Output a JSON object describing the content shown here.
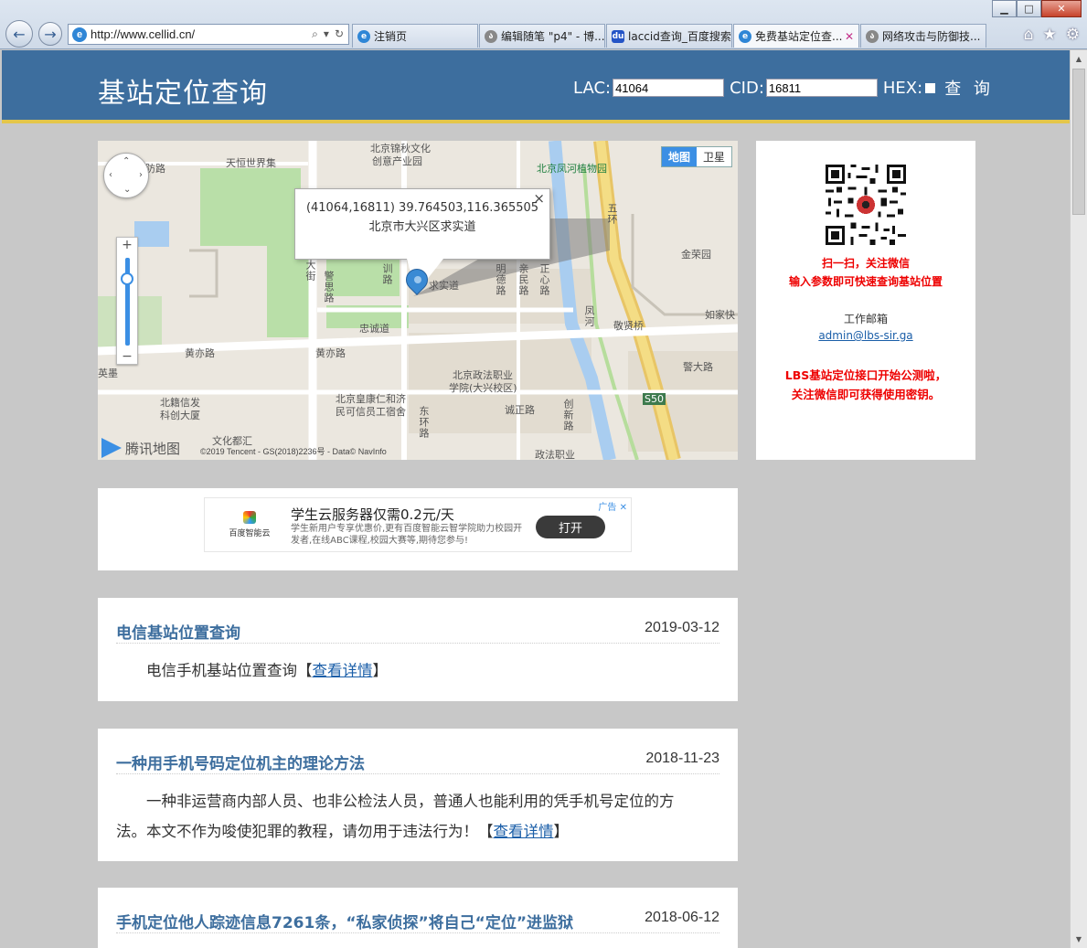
{
  "browser": {
    "url": "http://www.cellid.cn/",
    "tabs": [
      {
        "label": "注销页",
        "icon": "ie-icon",
        "active": false
      },
      {
        "label": "编辑随笔 \"p4\" - 博...",
        "icon": "blog-icon",
        "active": false
      },
      {
        "label": "laccid查询_百度搜索",
        "icon": "baidu-icon",
        "active": false
      },
      {
        "label": "免费基站定位查...",
        "icon": "ie-icon",
        "active": true
      },
      {
        "label": "网络攻击与防御技...",
        "icon": "blog-icon",
        "active": false
      }
    ]
  },
  "header": {
    "title": "基站定位查询",
    "lac_label": "LAC:",
    "lac_value": "41064",
    "cid_label": "CID:",
    "cid_value": "16811",
    "hex_label": "HEX:",
    "query_label": "查 询"
  },
  "map": {
    "type_map": "地图",
    "type_satellite": "卫星",
    "popup_line1": "(41064,16811) 39.764503,116.365505",
    "popup_line2": "北京市大兴区求实道",
    "logo": "腾讯地图",
    "copyright": "©2019 Tencent - GS(2018)2236号 - Data© NavInfo",
    "labels": {
      "l1": "北京锦秋文化",
      "l2": "创意产业园",
      "l3": "天恒世界集",
      "l4": "北京凤河植物园",
      "l5": "五环",
      "l6": "金荣园",
      "l7": "如家快",
      "l8": "敬贤桥",
      "l9": "警大路",
      "l10": "黄亦路",
      "l11": "英墨",
      "l12": "北籍信发",
      "l13": "科创大厦",
      "l14": "文化都汇",
      "l15": "北京政法职业",
      "l16": "学院(大兴校区)",
      "l17": "北京皇康仁和济",
      "l18": "民可信员工宿舍",
      "l19": "诚正路",
      "l20": "政法职业",
      "l21": "忠诚道",
      "l22": "求实道",
      "l23": "凤河",
      "l24": "S50",
      "l25": "防路",
      "v1": "警思路",
      "v2": "明德路",
      "v3": "亲民路",
      "v4": "正心路",
      "v5": "东环路",
      "v6": "创新路",
      "v7": "训路",
      "v8": "大街"
    }
  },
  "side": {
    "scan_line1": "扫一扫，关注微信",
    "scan_line2": "输入参数即可快速查询基站位置",
    "mail_label": "工作邮箱",
    "mail": "admin@lbs-sir.ga",
    "notice_line1": "LBS基站定位接口开始公测啦，",
    "notice_line2": "关注微信即可获得使用密钥。"
  },
  "ad": {
    "brand": "百度智能云",
    "headline": "学生云服务器仅需0.2元/天",
    "desc": "学生新用户专享优惠价,更有百度智能云智学院助力校园开发者,在线ABC课程,校园大赛等,期待您参与!",
    "button": "打开",
    "tag": "广告"
  },
  "articles": [
    {
      "title": "电信基站位置查询",
      "date": "2019-03-12",
      "body": "电信手机基站位置查询【",
      "link": "查看详情",
      "tail": "】"
    },
    {
      "title": "一种用手机号码定位机主的理论方法",
      "date": "2018-11-23",
      "body": "一种非运营商内部人员、也非公检法人员，普通人也能利用的凭手机号定位的方法。本文不作为唆使犯罪的教程，请勿用于违法行为！【",
      "link": "查看详情",
      "tail": "】"
    },
    {
      "title": "手机定位他人踪迹信息7261条，“私家侦探”将自己“定位”进监狱",
      "date": "2018-06-12"
    }
  ]
}
